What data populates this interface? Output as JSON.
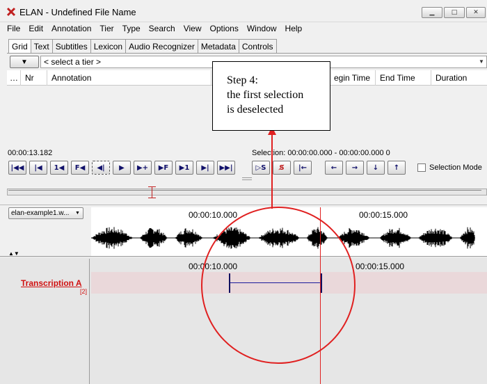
{
  "window": {
    "title": "ELAN - Undefined File Name",
    "min_glyph": "▁",
    "max_glyph": "□",
    "close_glyph": "✕"
  },
  "menu": [
    "File",
    "Edit",
    "Annotation",
    "Tier",
    "Type",
    "Search",
    "View",
    "Options",
    "Window",
    "Help"
  ],
  "tabs": [
    "Grid",
    "Text",
    "Subtitles",
    "Lexicon",
    "Audio Recognizer",
    "Metadata",
    "Controls"
  ],
  "active_tab": "Grid",
  "tier_selector": {
    "button_glyph": "▼",
    "placeholder": "< select a tier >"
  },
  "grid": {
    "columns": [
      "…",
      "Nr",
      "Annotation",
      "Begin Time",
      "End Time",
      "Duration"
    ],
    "visible_columns": {
      "dots": "…",
      "nr": "Nr",
      "annotation": "Annotation",
      "begin": "egin Time",
      "end": "End Time",
      "duration": "Duration"
    }
  },
  "media": {
    "current_time": "00:00:13.182",
    "selection": "Selection: 00:00:00.000 - 00:00:00.000  0"
  },
  "transport": {
    "buttons": [
      {
        "name": "go-to-begin",
        "glyph": "|◀◀"
      },
      {
        "name": "previous-frame-jump",
        "glyph": "|◀"
      },
      {
        "name": "step-back-pixel",
        "glyph": "1◀"
      },
      {
        "name": "step-back-frame",
        "glyph": "F◀"
      },
      {
        "name": "play-selection-back",
        "glyph": "◀|"
      },
      {
        "name": "play",
        "glyph": "▶"
      },
      {
        "name": "step-forward-pixel",
        "glyph": "▶+"
      },
      {
        "name": "step-forward-frame",
        "glyph": "▶F"
      },
      {
        "name": "next-pixel",
        "glyph": "▶1"
      },
      {
        "name": "next-frame-jump",
        "glyph": "▶|"
      },
      {
        "name": "go-to-end",
        "glyph": "▶▶|"
      }
    ],
    "selection_buttons": [
      {
        "name": "play-selection",
        "glyph": "▷S"
      },
      {
        "name": "clear-selection",
        "glyph": "S̸"
      },
      {
        "name": "jump-to-selection-begin",
        "glyph": "|←"
      }
    ],
    "nav_buttons": [
      {
        "name": "prev-annotation",
        "glyph": "←"
      },
      {
        "name": "next-annotation",
        "glyph": "→"
      },
      {
        "name": "annotation-below",
        "glyph": "↓"
      },
      {
        "name": "annotation-above",
        "glyph": "↑"
      }
    ],
    "selection_mode_label": "Selection Mode"
  },
  "waveform": {
    "media_file": "elan-example1.w...",
    "ruler_labels": [
      "00:00:10.000",
      "00:00:15.000"
    ]
  },
  "tiers": {
    "ruler_labels": [
      "00:00:10.000",
      "00:00:15.000"
    ],
    "tier_name": "Transcription A",
    "annotation_count": "[2]"
  },
  "callout": {
    "lines": [
      "Step 4:",
      "the first selection",
      "is deselected"
    ]
  },
  "colors": {
    "cursor": "#e02020",
    "tier_name": "#d01010",
    "segment": "#101060"
  }
}
